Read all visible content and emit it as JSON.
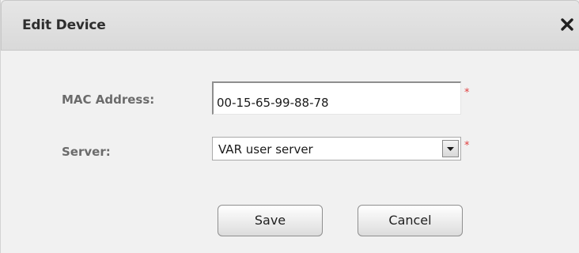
{
  "dialog": {
    "title": "Edit Device",
    "close_icon": "close-icon"
  },
  "form": {
    "mac_label": "MAC Address:",
    "mac_value": "00-15-65-99-88-78",
    "server_label": "Server:",
    "server_value": "VAR user server",
    "required_mark": "*",
    "dropdown_icon": "chevron-down-icon"
  },
  "actions": {
    "save_label": "Save",
    "cancel_label": "Cancel"
  },
  "colors": {
    "required": "#e04040",
    "label": "#6b6b6b",
    "titlebar": "#dedede"
  }
}
